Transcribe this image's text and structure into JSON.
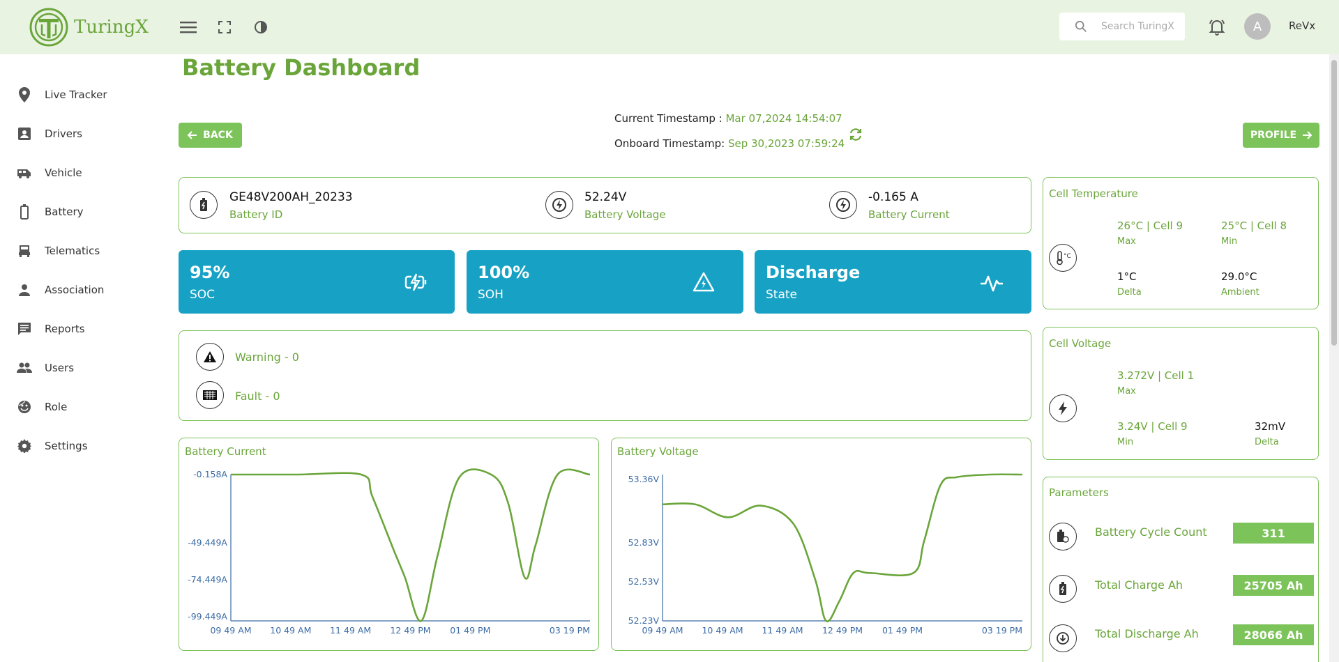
{
  "app": {
    "name": "TuringX"
  },
  "header": {
    "search_placeholder": "Search TuringX",
    "avatar_letter": "A",
    "username": "ReVx"
  },
  "sidebar": {
    "items": [
      {
        "label": "Live Tracker",
        "icon": "location-pin-icon"
      },
      {
        "label": "Drivers",
        "icon": "id-badge-icon"
      },
      {
        "label": "Vehicle",
        "icon": "bus-icon"
      },
      {
        "label": "Battery",
        "icon": "battery-icon"
      },
      {
        "label": "Telematics",
        "icon": "car-icon"
      },
      {
        "label": "Association",
        "icon": "person-icon"
      },
      {
        "label": "Reports",
        "icon": "message-icon"
      },
      {
        "label": "Users",
        "icon": "people-icon"
      },
      {
        "label": "Role",
        "icon": "face-icon"
      },
      {
        "label": "Settings",
        "icon": "gear-icon"
      }
    ]
  },
  "page": {
    "title": "Battery Dashboard",
    "back_label": "BACK",
    "profile_label": "PROFILE"
  },
  "timestamps": {
    "current_label": "Current Timestamp :",
    "current_value": "Mar 07,2024 14:54:07",
    "onboard_label": "Onboard Timestamp:",
    "onboard_value": "Sep 30,2023 07:59:24"
  },
  "info": {
    "battery_id": {
      "value": "GE48V200AH_20233",
      "label": "Battery ID"
    },
    "voltage": {
      "value": "52.24V",
      "label": "Battery Voltage"
    },
    "current": {
      "value": "-0.165 A",
      "label": "Battery Current"
    }
  },
  "tiles": [
    {
      "value": "95%",
      "label": "SOC"
    },
    {
      "value": "100%",
      "label": "SOH"
    },
    {
      "value": "Discharge",
      "label": "State"
    }
  ],
  "alerts": {
    "warning": "Warning - 0",
    "fault": "Fault - 0"
  },
  "cell_temperature": {
    "title": "Cell Temperature",
    "max_value": "26°C | Cell 9",
    "max_label": "Max",
    "min_value": "25°C | Cell 8",
    "min_label": "Min",
    "delta_value": "1°C",
    "delta_label": "Delta",
    "ambient_value": "29.0°C",
    "ambient_label": "Ambient"
  },
  "cell_voltage": {
    "title": "Cell Voltage",
    "max_value": "3.272V | Cell 1",
    "max_label": "Max",
    "min_value": "3.24V | Cell 9",
    "min_label": "Min",
    "delta_value": "32mV",
    "delta_label": "Delta"
  },
  "parameters": {
    "title": "Parameters",
    "items": [
      {
        "label": "Battery Cycle Count",
        "value": "311"
      },
      {
        "label": "Total Charge Ah",
        "value": "25705 Ah"
      },
      {
        "label": "Total Discharge Ah",
        "value": "28066 Ah"
      }
    ]
  },
  "colors": {
    "accent": "#6aa53a",
    "button": "#7cc35a",
    "tile": "#17a2c5",
    "header_bg": "#e9f3e2",
    "axis": "#3b6ba5"
  },
  "chart_data": [
    {
      "type": "line",
      "title": "Battery Current",
      "x_ticks": [
        "09 49 AM",
        "10 49 AM",
        "11 49 AM",
        "12 49 PM",
        "01 49 PM",
        "03 19 PM"
      ],
      "y_ticks": [
        "-0.158A",
        "-49.449A",
        "-74.449A",
        "-99.449A"
      ],
      "ylim": [
        -99.449,
        -0.158
      ],
      "series": [
        {
          "x": [
            0,
            60,
            120,
            130,
            150,
            160,
            175,
            190,
            210,
            240,
            255,
            270,
            280,
            300,
            330
          ],
          "y": [
            -0.158,
            -0.158,
            -0.2,
            -15,
            -52,
            -70,
            -99.449,
            -55,
            -2,
            -0.5,
            -20,
            -70,
            -48,
            -0.3,
            -0.158
          ]
        }
      ]
    },
    {
      "type": "line",
      "title": "Battery Voltage",
      "x_ticks": [
        "09 49 AM",
        "10 49 AM",
        "11 49 AM",
        "12 49 PM",
        "01 49 PM",
        "03 19 PM"
      ],
      "y_ticks": [
        "53.36V",
        "52.83V",
        "52.53V",
        "52.23V"
      ],
      "ylim": [
        52.23,
        53.36
      ],
      "series": [
        {
          "x": [
            0,
            30,
            60,
            90,
            120,
            140,
            150,
            162,
            175,
            190,
            230,
            240,
            255,
            270,
            300,
            330
          ],
          "y": [
            53.13,
            53.13,
            53.03,
            53.12,
            52.98,
            52.55,
            52.23,
            52.38,
            52.6,
            52.6,
            52.6,
            52.85,
            53.28,
            53.34,
            53.36,
            53.36
          ]
        }
      ]
    }
  ]
}
